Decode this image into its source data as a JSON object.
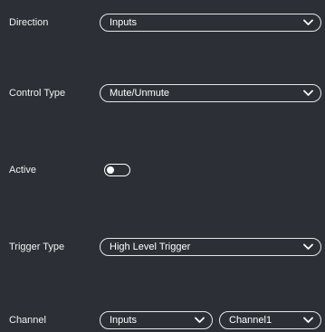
{
  "colors": {
    "background": "#2c3036",
    "foreground": "#ffffff",
    "border": "#e6e6e6"
  },
  "fields": {
    "direction": {
      "label": "Direction",
      "value": "Inputs"
    },
    "control_type": {
      "label": "Control Type",
      "value": "Mute/Unmute"
    },
    "active": {
      "label": "Active",
      "on": false
    },
    "trigger_type": {
      "label": "Trigger Type",
      "value": "High Level Trigger"
    },
    "channel": {
      "label": "Channel",
      "value": "Inputs",
      "channel_value": "Channel1"
    }
  },
  "icons": {
    "dropdown": "chevron-down-icon"
  }
}
